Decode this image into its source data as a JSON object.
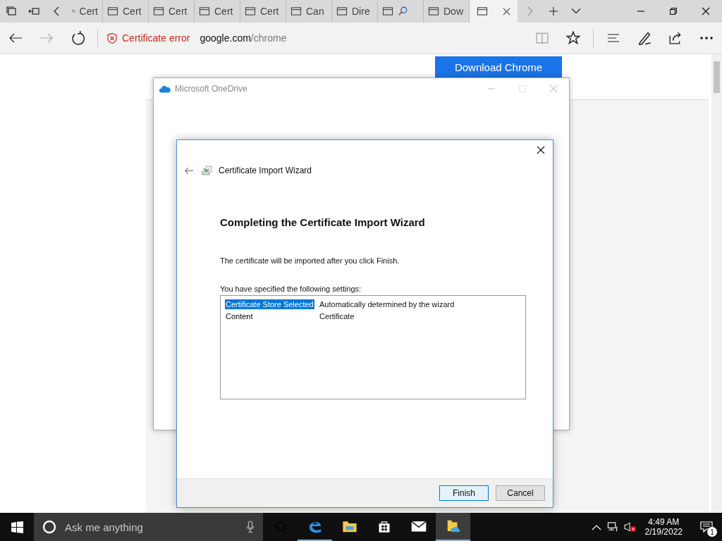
{
  "browser": {
    "tabs": [
      {
        "label": "Cert",
        "selected": false
      },
      {
        "label": "Cert",
        "selected": false
      },
      {
        "label": "Cert",
        "selected": false
      },
      {
        "label": "Cert",
        "selected": false
      },
      {
        "label": "Cert",
        "selected": false
      },
      {
        "label": "Can",
        "selected": false
      },
      {
        "label": "Dire",
        "selected": false
      },
      {
        "kind": "search",
        "selected": false
      },
      {
        "label": "Dow",
        "selected": false
      },
      {
        "selected": true
      }
    ],
    "address": {
      "security": "Certificate error",
      "host": "google.com",
      "path": "/chrome"
    }
  },
  "page": {
    "download_button": "Download Chrome"
  },
  "onedrive_window": {
    "title": "Microsoft OneDrive"
  },
  "wizard": {
    "title": "Certificate Import Wizard",
    "heading": "Completing the Certificate Import Wizard",
    "intro": "The certificate will be imported after you click Finish.",
    "settings_label": "You have specified the following settings:",
    "settings": [
      {
        "name": "Certificate Store Selected",
        "value": "Automatically determined by the wizard",
        "selected": true
      },
      {
        "name": "Content",
        "value": "Certificate",
        "selected": false
      }
    ],
    "buttons": [
      {
        "label": "Finish",
        "kind": "default"
      },
      {
        "label": "Cancel",
        "kind": "normal"
      }
    ]
  },
  "taskbar": {
    "search": {
      "placeholder": "Ask me anything"
    },
    "apps": [
      {
        "kind": "task-view",
        "running": false,
        "selected": false
      },
      {
        "kind": "edge",
        "running": true,
        "selected": false
      },
      {
        "kind": "explorer",
        "running": false,
        "selected": false
      },
      {
        "kind": "store",
        "running": false,
        "selected": false
      },
      {
        "kind": "mail",
        "running": false,
        "selected": false
      },
      {
        "kind": "onedrive-folder",
        "running": true,
        "selected": true
      }
    ],
    "time": "4:49 AM",
    "date": "2/19/2022",
    "notifications": "1"
  }
}
